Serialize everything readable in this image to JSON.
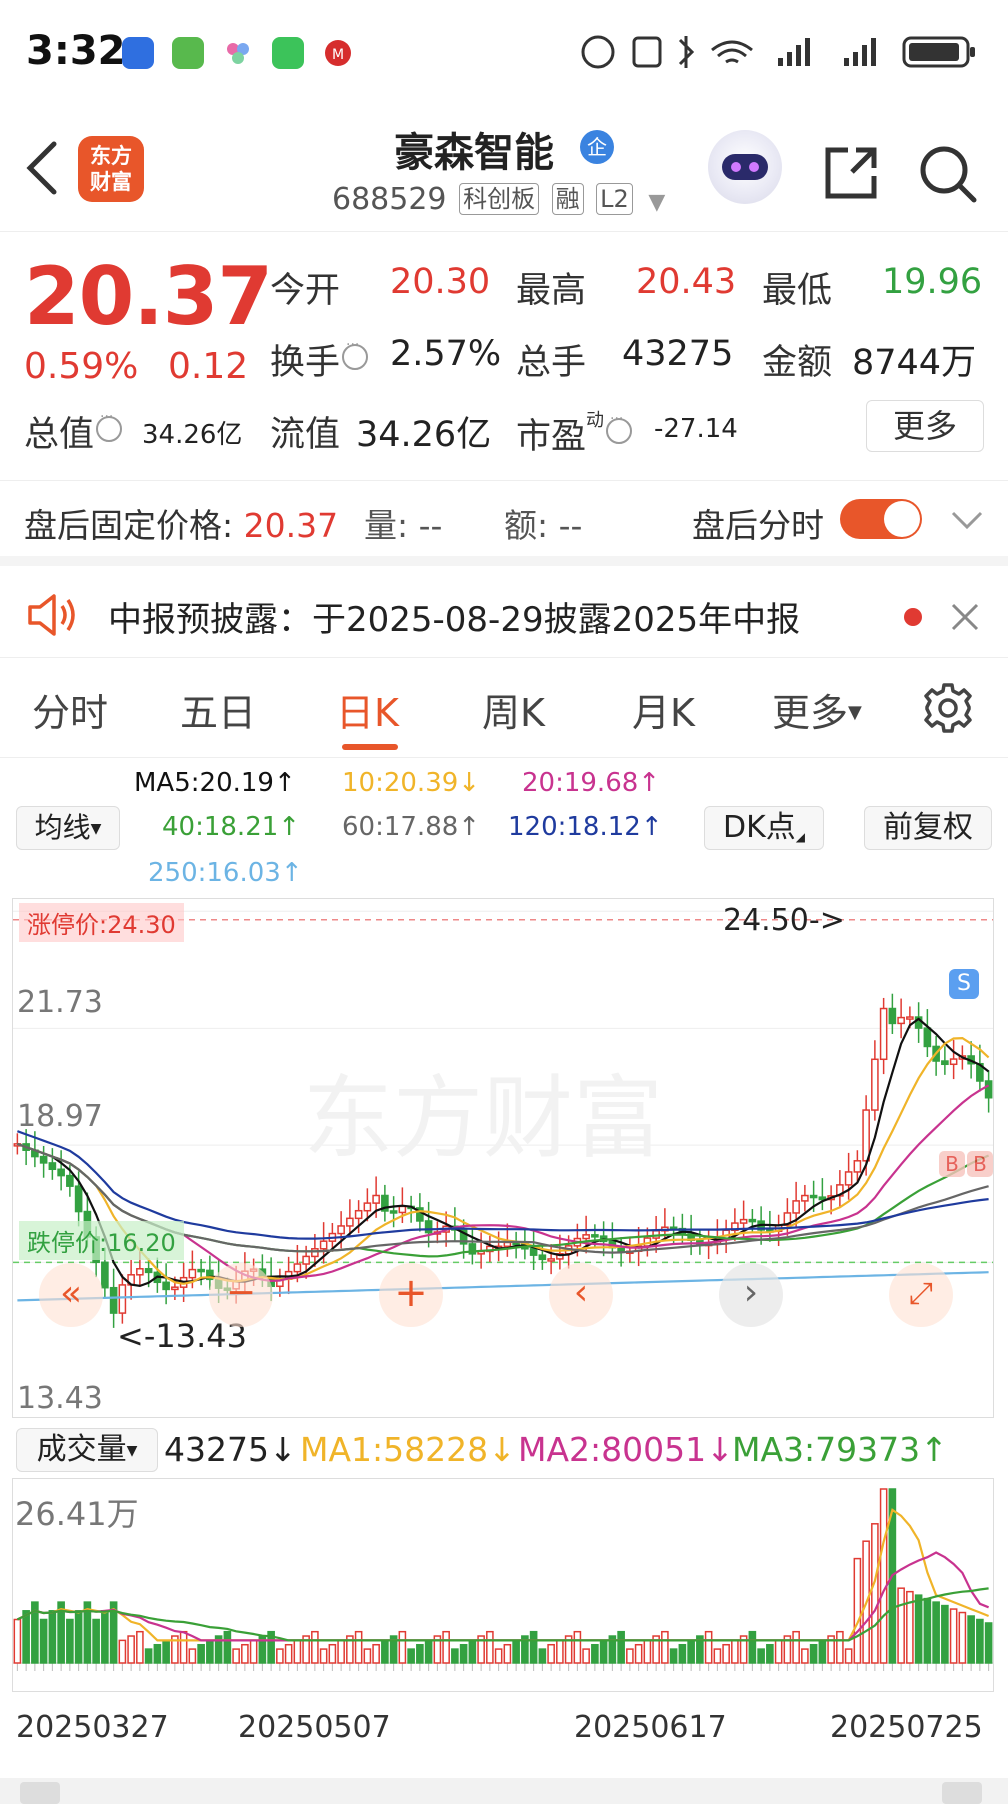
{
  "status_bar": {
    "time": "3:32"
  },
  "header": {
    "back_icon": "chevron-left-icon",
    "logo_line1": "东方",
    "logo_line2": "财富",
    "stock_name": "豪森智能",
    "name_badge": "企",
    "code": "688529",
    "tags": [
      "科创板",
      "融",
      "L2"
    ]
  },
  "quote": {
    "price": "20.37",
    "change_pct": "0.59%",
    "change_abs": "0.12",
    "fields": {
      "open_label": "今开",
      "open": "20.30",
      "high_label": "最高",
      "high": "20.43",
      "low_label": "最低",
      "low": "19.96",
      "turnover_label": "换手",
      "turnover": "2.57%",
      "volume_label": "总手",
      "volume": "43275",
      "amount_label": "金额",
      "amount": "8744万",
      "mktcap_label": "总值",
      "mktcap": "34.26亿",
      "float_label": "流值",
      "float": "34.26亿",
      "pe_label": "市盈",
      "pe_sup": "动",
      "pe": "-27.14"
    },
    "more_button": "更多"
  },
  "after_hours": {
    "label": "盘后固定价格:",
    "price": "20.37",
    "volume_label": "量:",
    "volume": "--",
    "amount_label": "额:",
    "amount": "--",
    "toggle_label": "盘后分时",
    "toggle_on": true
  },
  "notice": {
    "text": "中报预披露：于2025-08-29披露2025年中报"
  },
  "tabs": [
    "分时",
    "五日",
    "日K",
    "周K",
    "月K",
    "更多"
  ],
  "active_tab": "日K",
  "ma_row": {
    "indicator_select": "均线",
    "ma5": "MA5:20.19↑",
    "ma10": "10:20.39↓",
    "ma20": "20:19.68↑",
    "ma40": "40:18.21↑",
    "ma60": "60:17.88↑",
    "ma120": "120:18.12↑",
    "ma250": "250:16.03↑",
    "dk_button": "DK点",
    "adjust_button": "前复权"
  },
  "colors": {
    "up": "#e03a32",
    "down": "#33a141",
    "accent": "#e8562a",
    "ma5": "#111111",
    "ma10": "#f0b429",
    "ma20": "#c8338f",
    "ma40": "#3aa037",
    "ma60": "#666666",
    "ma120": "#1f3b9e",
    "ma250": "#6cb4e4"
  },
  "kline": {
    "limit_up_label": "涨停价:24.30",
    "limit_down_label": "跌停价:16.20",
    "y_labels": [
      "24.50",
      "21.73",
      "18.97",
      "16.20",
      "13.43"
    ],
    "max_marker": "24.50->",
    "min_marker": "<-13.43",
    "sell_badge": "S",
    "buy_badge": "B"
  },
  "volume": {
    "select": "成交量",
    "value": "43275↓",
    "ma1": "MA1:58228↓",
    "ma2": "MA2:80051↓",
    "ma3": "MA3:79373↑",
    "max_label": "26.41万"
  },
  "dates": [
    "20250327",
    "20250507",
    "20250617",
    "20250725"
  ]
}
